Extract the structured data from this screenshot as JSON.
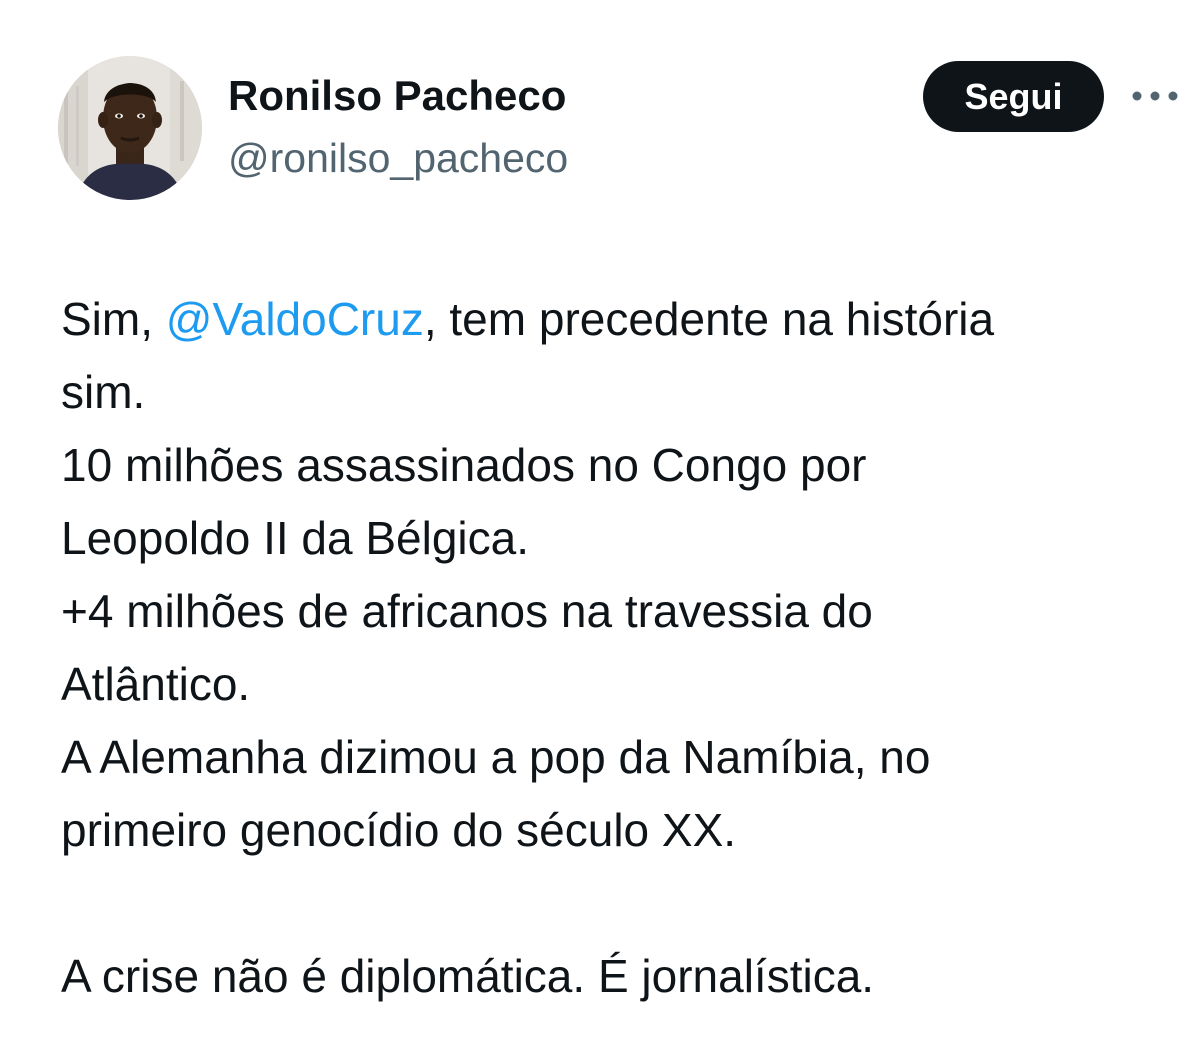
{
  "author": {
    "name": "Ronilso Pacheco",
    "handle": "@ronilso_pacheco"
  },
  "follow_button": {
    "label": "Segui"
  },
  "more_icon": "more-horizontal-icon",
  "tweet": {
    "line1_before": "Sim, ",
    "mention": "@ValdoCruz",
    "line1_after": ", tem precedente na história",
    "line2": "sim.",
    "line3": "10 milhões assassinados no Congo por",
    "line4": "Leopoldo II da Bélgica.",
    "line5": "+4 milhões de africanos na travessia do",
    "line6": "Atlântico.",
    "line7": "A Alemanha dizimou a pop da Namíbia, no",
    "line8": "primeiro genocídio do século XX.",
    "line9": "A crise não é diplomática. É jornalística."
  },
  "colors": {
    "text": "#0f1419",
    "secondary": "#536471",
    "link": "#1d9bf0",
    "button_bg": "#0f1419",
    "button_text": "#ffffff"
  }
}
